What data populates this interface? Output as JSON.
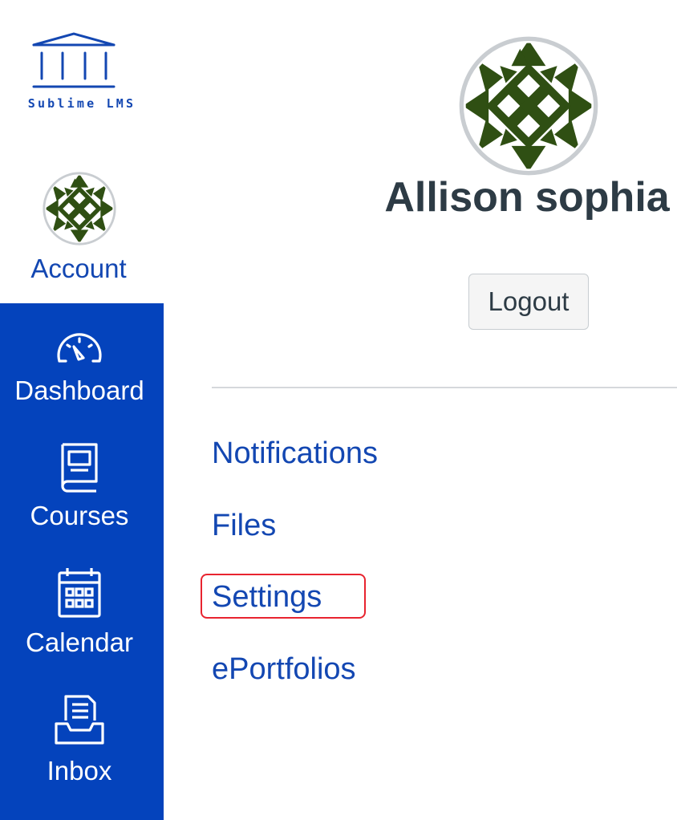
{
  "brand": {
    "name": "Sublime LMS",
    "logo_icon": "columns-building-icon",
    "color": "#1347b2"
  },
  "sidebar": {
    "background": "#0443bc",
    "account": {
      "label": "Account",
      "icon": "avatar"
    },
    "items": [
      {
        "label": "Dashboard",
        "icon": "speedometer-icon"
      },
      {
        "label": "Courses",
        "icon": "book-icon"
      },
      {
        "label": "Calendar",
        "icon": "calendar-icon"
      },
      {
        "label": "Inbox",
        "icon": "inbox-icon"
      }
    ]
  },
  "profile": {
    "name": "Allison sophia",
    "logout_label": "Logout"
  },
  "menu": {
    "items": [
      {
        "label": "Notifications"
      },
      {
        "label": "Files"
      },
      {
        "label": "Settings",
        "highlighted": true
      },
      {
        "label": "ePortfolios"
      }
    ],
    "highlight_color": "#e8242f"
  }
}
